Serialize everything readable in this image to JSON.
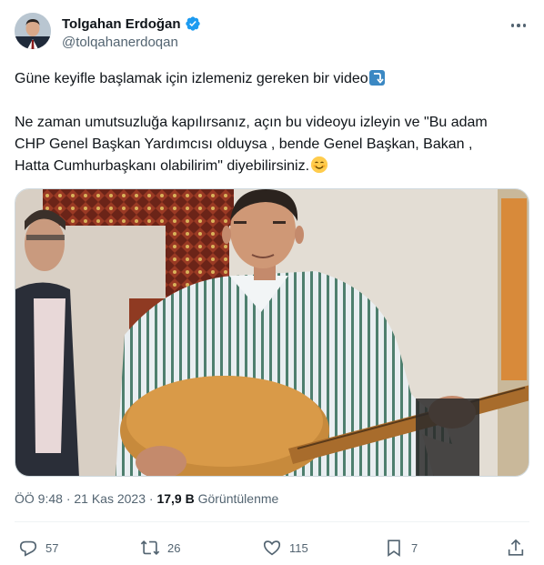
{
  "author": {
    "display_name": "Tolgahan Erdoğan",
    "handle": "@tolqahanerdoqan",
    "verified": true,
    "avatar_icon": "profile-photo"
  },
  "tweet": {
    "line1": "Güne keyifle başlamak için izlemeniz gereken bir video",
    "line1_emoji": "down-arrow-emoji",
    "paragraph2_line1": "Ne zaman umutsuzluğa kapılırsanız, açın bu videoyu izleyin ve \"Bu adam",
    "paragraph2_line2": "CHP Genel Başkan Yardımcısı olduysa , bende Genel Başkan, Bakan ,",
    "paragraph2_line3": "Hatta Cumhurbaşkanı olabilirim\" diyebilirsiniz.",
    "paragraph2_emoji": "smiling-face-emoji"
  },
  "meta": {
    "time": "ÖÖ 9:48",
    "separator": "·",
    "date": "21 Kas 2023",
    "views_count": "17,9 B",
    "views_label": "Görüntülenme"
  },
  "actions": {
    "replies": "57",
    "reposts": "26",
    "likes": "115",
    "bookmarks": "7"
  },
  "colors": {
    "text_primary": "#0f1419",
    "text_secondary": "#536471",
    "verified_blue": "#1d9bf0",
    "border": "#cfd9de"
  }
}
